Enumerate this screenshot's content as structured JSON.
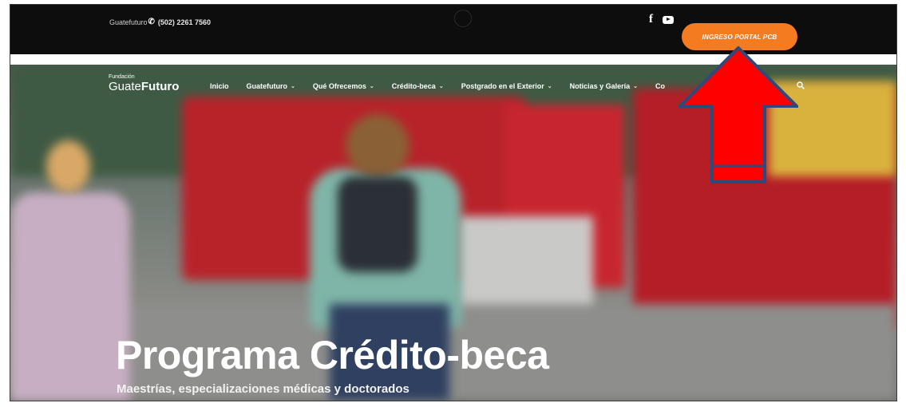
{
  "topbar": {
    "brand": "Guatefuturo",
    "phone": "(502) 2261 7560",
    "social": [
      {
        "icon": "facebook-icon",
        "label": "f"
      },
      {
        "icon": "youtube-icon",
        "label": ""
      }
    ],
    "portal_button": "INGRESO PORTAL PCB"
  },
  "logo": {
    "small": "Fundación",
    "main_light": "Guate",
    "main_bold": "Futuro"
  },
  "nav": {
    "items": [
      {
        "label": "Inicio",
        "has_dropdown": false,
        "active": true
      },
      {
        "label": "Guatefuturo",
        "has_dropdown": true
      },
      {
        "label": "Qué Ofrecemos",
        "has_dropdown": true
      },
      {
        "label": "Crédito-beca",
        "has_dropdown": true
      },
      {
        "label": "Postgrado en el Exterior",
        "has_dropdown": true
      },
      {
        "label": "Noticias y Galería",
        "has_dropdown": true
      },
      {
        "label": "Co",
        "has_dropdown": false
      }
    ],
    "chevron": "⌄"
  },
  "hero": {
    "title": "Programa Crédito-beca",
    "subtitle": "Maestrías, especializaciones médicas y doctorados"
  },
  "colors": {
    "accent": "#f47b20",
    "arrow_fill": "#ff0000",
    "arrow_stroke": "#2f4a7a"
  }
}
